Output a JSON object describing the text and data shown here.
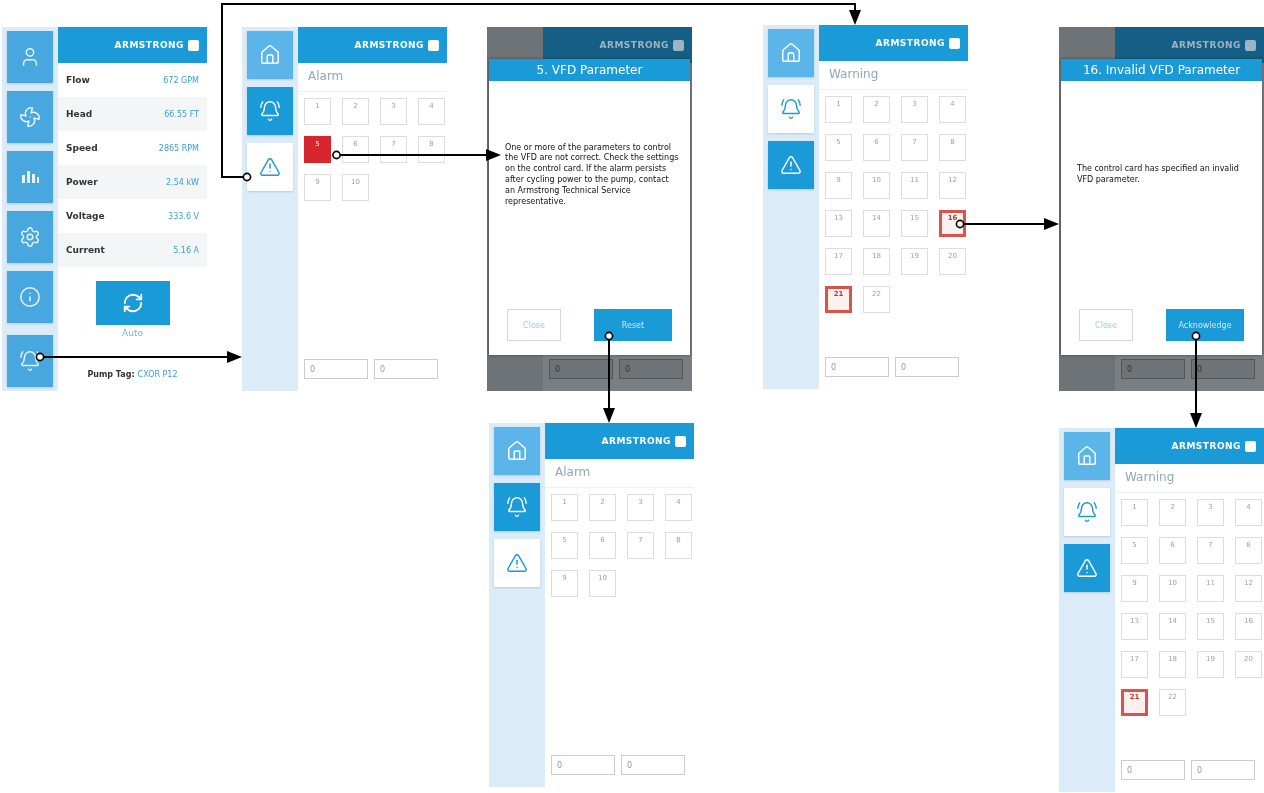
{
  "screens": [
    {
      "kind": "home",
      "logo": "ARMSTRONG",
      "nav": [
        {
          "kind": "user",
          "selected": false
        },
        {
          "kind": "pump",
          "selected": false
        },
        {
          "kind": "chart",
          "selected": false
        },
        {
          "kind": "settings",
          "selected": false
        },
        {
          "kind": "info",
          "selected": false
        },
        {
          "kind": "alarm",
          "selected": false
        }
      ],
      "readings": [
        {
          "label": "Flow",
          "value": "672 GPM"
        },
        {
          "label": "Head",
          "value": "66.55 FT"
        },
        {
          "label": "Speed",
          "value": "2865 RPM"
        },
        {
          "label": "Power",
          "value": "2.54 kW"
        },
        {
          "label": "Voltage",
          "value": "333.6 V"
        },
        {
          "label": "Current",
          "value": "5.16 A"
        }
      ],
      "mode_button": {
        "label": "Auto"
      },
      "pump_tag": {
        "label": "Pump Tag:",
        "value": "CXOR P12"
      }
    },
    {
      "kind": "list",
      "logo": "ARMSTRONG",
      "nav": [
        {
          "kind": "home",
          "selected": false
        },
        {
          "kind": "alarm",
          "selected": true
        },
        {
          "kind": "warning",
          "selected": false
        }
      ],
      "title": "Alarm",
      "codes": [
        {
          "label": "1",
          "active": false
        },
        {
          "label": "2",
          "active": false
        },
        {
          "label": "3",
          "active": false
        },
        {
          "label": "4",
          "active": false
        },
        {
          "label": "5",
          "active": true
        },
        {
          "label": "6",
          "active": false
        },
        {
          "label": "7",
          "active": false
        },
        {
          "label": "8",
          "active": false
        },
        {
          "label": "9",
          "active": false
        },
        {
          "label": "10",
          "active": false
        }
      ],
      "fields": [
        "0",
        "0"
      ]
    },
    {
      "kind": "dialog",
      "logo": "ARMSTRONG",
      "dialog": {
        "title": "5. VFD Parameter",
        "message": "One or more of the parameters to control the VFD are not correct. Check the settings on the control card. If the alarm persists after cycling power to the pump, contact an Armstrong Technical Service representative.",
        "buttons": [
          {
            "label": "Close",
            "kind": "secondary"
          },
          {
            "label": "Reset",
            "kind": "primary"
          }
        ]
      },
      "fields": [
        "0",
        "0"
      ]
    },
    {
      "kind": "list",
      "logo": "ARMSTRONG",
      "nav": [
        {
          "kind": "home",
          "selected": false
        },
        {
          "kind": "alarm",
          "selected": true
        },
        {
          "kind": "warning",
          "selected": false
        }
      ],
      "title": "Alarm",
      "codes": [
        {
          "label": "1",
          "active": false
        },
        {
          "label": "2",
          "active": false
        },
        {
          "label": "3",
          "active": false
        },
        {
          "label": "4",
          "active": false
        },
        {
          "label": "5",
          "active": false
        },
        {
          "label": "6",
          "active": false
        },
        {
          "label": "7",
          "active": false
        },
        {
          "label": "8",
          "active": false
        },
        {
          "label": "9",
          "active": false
        },
        {
          "label": "10",
          "active": false
        }
      ],
      "fields": [
        "0",
        "0"
      ]
    },
    {
      "kind": "list",
      "logo": "ARMSTRONG",
      "nav": [
        {
          "kind": "home",
          "selected": false
        },
        {
          "kind": "alarm",
          "selected": false
        },
        {
          "kind": "warning",
          "selected": true
        }
      ],
      "title": "Warning",
      "codes": [
        {
          "label": "1",
          "active": false
        },
        {
          "label": "2",
          "active": false
        },
        {
          "label": "3",
          "active": false
        },
        {
          "label": "4",
          "active": false
        },
        {
          "label": "5",
          "active": false
        },
        {
          "label": "6",
          "active": false
        },
        {
          "label": "7",
          "active": false
        },
        {
          "label": "8",
          "active": false
        },
        {
          "label": "9",
          "active": false
        },
        {
          "label": "10",
          "active": false
        },
        {
          "label": "11",
          "active": false
        },
        {
          "label": "12",
          "active": false
        },
        {
          "label": "13",
          "active": false
        },
        {
          "label": "14",
          "active": false
        },
        {
          "label": "15",
          "active": false
        },
        {
          "label": "16",
          "active": true
        },
        {
          "label": "17",
          "active": false
        },
        {
          "label": "18",
          "active": false
        },
        {
          "label": "19",
          "active": false
        },
        {
          "label": "20",
          "active": false
        },
        {
          "label": "21",
          "active": true
        },
        {
          "label": "22",
          "active": false
        }
      ],
      "fields": [
        "0",
        "0"
      ]
    },
    {
      "kind": "dialog",
      "logo": "ARMSTRONG",
      "dialog": {
        "title": "16. Invalid VFD Parameter",
        "message": "The control card has specified an invalid VFD parameter.",
        "buttons": [
          {
            "label": "Close",
            "kind": "secondary"
          },
          {
            "label": "Acknowledge",
            "kind": "primary"
          }
        ]
      },
      "fields": [
        "0",
        "0"
      ]
    },
    {
      "kind": "list",
      "logo": "ARMSTRONG",
      "nav": [
        {
          "kind": "home",
          "selected": false
        },
        {
          "kind": "alarm",
          "selected": false
        },
        {
          "kind": "warning",
          "selected": true
        }
      ],
      "title": "Warning",
      "codes": [
        {
          "label": "1",
          "active": false
        },
        {
          "label": "2",
          "active": false
        },
        {
          "label": "3",
          "active": false
        },
        {
          "label": "4",
          "active": false
        },
        {
          "label": "5",
          "active": false
        },
        {
          "label": "6",
          "active": false
        },
        {
          "label": "7",
          "active": false
        },
        {
          "label": "8",
          "active": false
        },
        {
          "label": "9",
          "active": false
        },
        {
          "label": "10",
          "active": false
        },
        {
          "label": "11",
          "active": false
        },
        {
          "label": "12",
          "active": false
        },
        {
          "label": "13",
          "active": false
        },
        {
          "label": "14",
          "active": false
        },
        {
          "label": "15",
          "active": false
        },
        {
          "label": "16",
          "active": false
        },
        {
          "label": "17",
          "active": false
        },
        {
          "label": "18",
          "active": false
        },
        {
          "label": "19",
          "active": false
        },
        {
          "label": "20",
          "active": false
        },
        {
          "label": "21",
          "active": true
        },
        {
          "label": "22",
          "active": false
        }
      ],
      "fields": [
        "0",
        "0"
      ]
    }
  ]
}
